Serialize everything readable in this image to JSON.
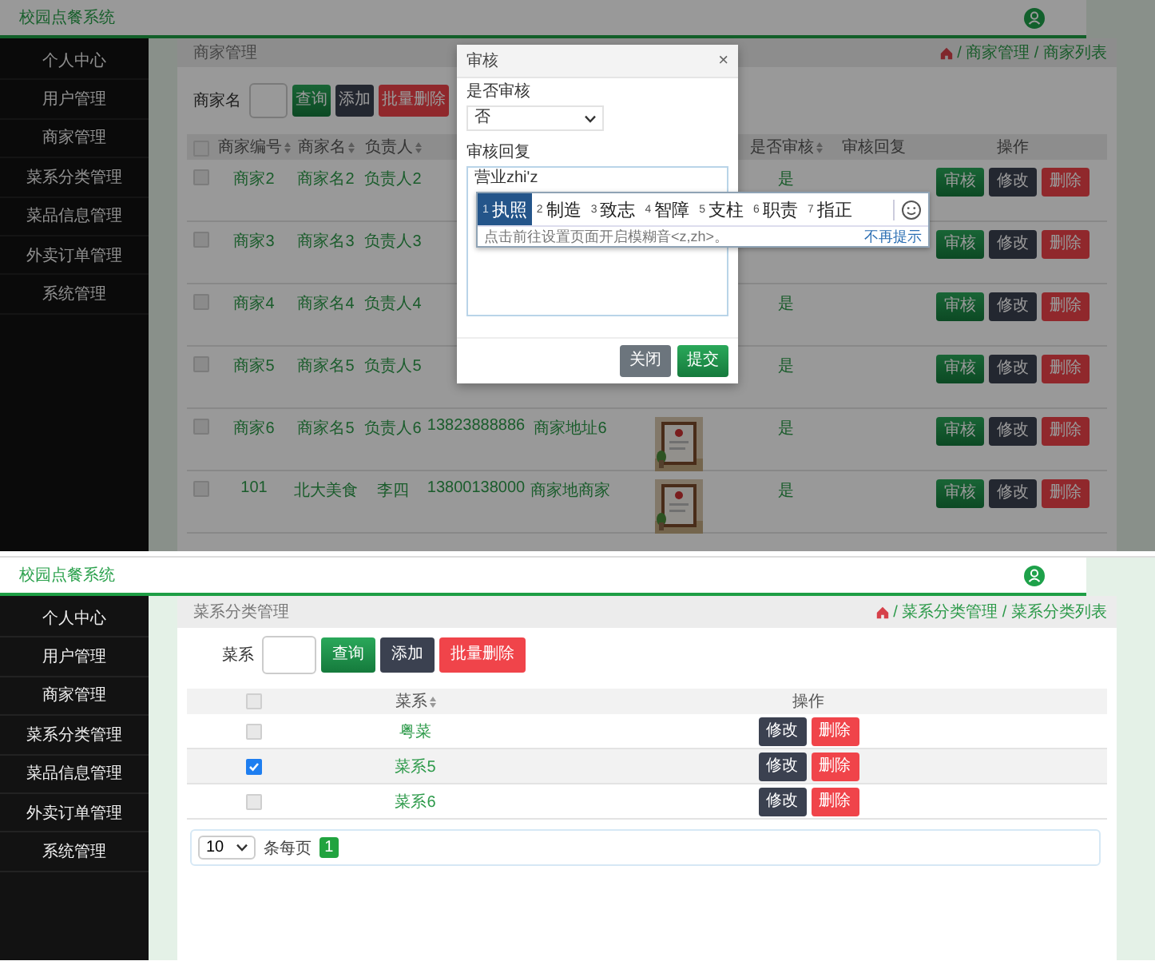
{
  "screens": [
    {
      "app_title": "校园点餐系统",
      "sidebar": {
        "items": [
          {
            "label": "个人中心"
          },
          {
            "label": "用户管理"
          },
          {
            "label": "商家管理"
          },
          {
            "label": "菜系分类管理"
          },
          {
            "label": "菜品信息管理"
          },
          {
            "label": "外卖订单管理"
          },
          {
            "label": "系统管理"
          }
        ]
      },
      "breadcrumb": {
        "title": "商家管理",
        "trail": "/ 商家管理 / 商家列表"
      },
      "search": {
        "label": "商家名",
        "buttons": [
          {
            "label": "查询",
            "kind": "search"
          },
          {
            "label": "添加",
            "kind": "add"
          },
          {
            "label": "批量删除",
            "kind": "delete"
          }
        ]
      },
      "table": {
        "header_checked": false,
        "columns": [
          {
            "label": "商家编号",
            "sortable": true
          },
          {
            "label": "商家名",
            "sortable": true
          },
          {
            "label": "负责人",
            "sortable": true
          },
          null,
          null,
          null,
          {
            "label": "是否审核",
            "sortable": true
          },
          {
            "label": "审核回复",
            "sortable": false
          },
          {
            "label": "操作",
            "sortable": false
          }
        ],
        "rows": [
          {
            "checked": false,
            "cells": [
              "商家2",
              "商家名2",
              "负责人2",
              null,
              null,
              null,
              "是",
              null
            ],
            "actions": [
              {
                "label": "审核",
                "kind": "audit"
              },
              {
                "label": "修改",
                "kind": "edit"
              },
              {
                "label": "删除",
                "kind": "delete"
              }
            ]
          },
          {
            "checked": false,
            "cells": [
              "商家3",
              "商家名3",
              "负责人3",
              null,
              null,
              null,
              null,
              null
            ],
            "actions": [
              {
                "label": "审核",
                "kind": "audit"
              },
              {
                "label": "修改",
                "kind": "edit"
              },
              {
                "label": "删除",
                "kind": "delete"
              }
            ]
          },
          {
            "checked": false,
            "cells": [
              "商家4",
              "商家名4",
              "负责人4",
              null,
              null,
              null,
              "是",
              null
            ],
            "actions": [
              {
                "label": "审核",
                "kind": "audit"
              },
              {
                "label": "修改",
                "kind": "edit"
              },
              {
                "label": "删除",
                "kind": "delete"
              }
            ]
          },
          {
            "checked": false,
            "cells": [
              "商家5",
              "商家名5",
              "负责人5",
              null,
              null,
              null,
              "是",
              null
            ],
            "actions": [
              {
                "label": "审核",
                "kind": "audit"
              },
              {
                "label": "修改",
                "kind": "edit"
              },
              {
                "label": "删除",
                "kind": "delete"
              }
            ]
          },
          {
            "checked": false,
            "cells": [
              "商家6",
              "商家名5",
              "负责人6",
              "13823888886",
              "商家地址6",
              {
                "kind": "picture"
              },
              "是",
              null
            ],
            "actions": [
              {
                "label": "审核",
                "kind": "audit"
              },
              {
                "label": "修改",
                "kind": "edit"
              },
              {
                "label": "删除",
                "kind": "delete"
              }
            ]
          },
          {
            "checked": false,
            "cells": [
              "101",
              "北大美食",
              "李四",
              "13800138000",
              "商家地商家",
              {
                "kind": "picture"
              },
              "是",
              null
            ],
            "actions": [
              {
                "label": "审核",
                "kind": "audit"
              },
              {
                "label": "修改",
                "kind": "edit"
              },
              {
                "label": "删除",
                "kind": "delete"
              }
            ]
          }
        ]
      },
      "modal": {
        "title": "审核",
        "close": "×",
        "fields": [
          {
            "label": "是否审核",
            "kind": "select",
            "value": "否"
          },
          {
            "label": "审核回复",
            "kind": "textarea",
            "value": "营业zhi'z"
          }
        ],
        "buttons": [
          {
            "label": "关闭",
            "kind": "close"
          },
          {
            "label": "提交",
            "kind": "submit"
          }
        ]
      },
      "ime": {
        "candidates": [
          {
            "index": "1",
            "text": "执照",
            "selected": true
          },
          {
            "index": "2",
            "text": "制造",
            "selected": false
          },
          {
            "index": "3",
            "text": "致志",
            "selected": false
          },
          {
            "index": "4",
            "text": "智障",
            "selected": false
          },
          {
            "index": "5",
            "text": "支柱",
            "selected": false
          },
          {
            "index": "6",
            "text": "职责",
            "selected": false
          },
          {
            "index": "7",
            "text": "指正",
            "selected": false
          }
        ],
        "hint": "点击前往设置页面开启模糊音<z,zh>。",
        "dismiss": "不再提示"
      }
    },
    {
      "app_title": "校园点餐系统",
      "sidebar": {
        "items": [
          {
            "label": "个人中心"
          },
          {
            "label": "用户管理"
          },
          {
            "label": "商家管理"
          },
          {
            "label": "菜系分类管理"
          },
          {
            "label": "菜品信息管理"
          },
          {
            "label": "外卖订单管理"
          },
          {
            "label": "系统管理"
          }
        ]
      },
      "breadcrumb": {
        "title": "菜系分类管理",
        "trail": "/ 菜系分类管理 / 菜系分类列表"
      },
      "search": {
        "label": "菜系",
        "buttons": [
          {
            "label": "查询",
            "kind": "search"
          },
          {
            "label": "添加",
            "kind": "add"
          },
          {
            "label": "批量删除",
            "kind": "delete"
          }
        ]
      },
      "table": {
        "header_checked": false,
        "columns": [
          {
            "label": "菜系",
            "sortable": true
          },
          {
            "label": "操作",
            "sortable": false
          }
        ],
        "rows": [
          {
            "checked": false,
            "cells": [
              "粤菜"
            ],
            "actions": [
              {
                "label": "修改",
                "kind": "edit"
              },
              {
                "label": "删除",
                "kind": "delete"
              }
            ]
          },
          {
            "checked": true,
            "cells": [
              "菜系5"
            ],
            "actions": [
              {
                "label": "修改",
                "kind": "edit"
              },
              {
                "label": "删除",
                "kind": "delete"
              }
            ]
          },
          {
            "checked": false,
            "cells": [
              "菜系6"
            ],
            "actions": [
              {
                "label": "修改",
                "kind": "edit"
              },
              {
                "label": "删除",
                "kind": "delete"
              }
            ]
          }
        ]
      },
      "pagination": {
        "page_size": "10",
        "unit": "条每页",
        "pages": [
          {
            "label": "1",
            "selected": true
          }
        ]
      }
    }
  ]
}
